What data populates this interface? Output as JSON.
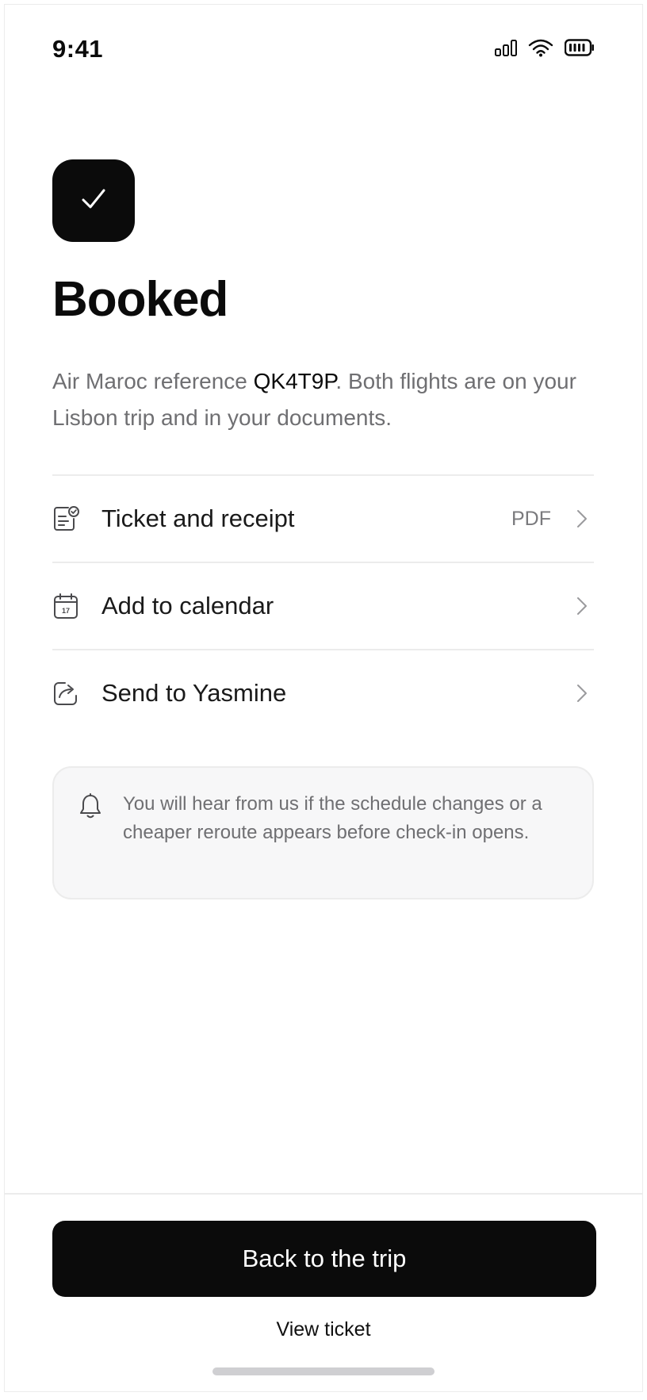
{
  "status_bar": {
    "time": "9:41",
    "icons": [
      "signal-icon",
      "wifi-icon",
      "battery-icon"
    ]
  },
  "badge": {
    "icon": "checkmark-icon"
  },
  "title": "Booked",
  "intro": {
    "prefix": "Air Maroc reference ",
    "reference": "QK4T9P",
    "suffix": ". Both flights are on your Lisbon trip and in your documents."
  },
  "actions": [
    {
      "label": "Ticket and receipt",
      "meta": "PDF",
      "icon": "receipt-check-icon"
    },
    {
      "label": "Add to calendar",
      "meta": "",
      "icon": "calendar-icon"
    },
    {
      "label": "Send to Yasmine",
      "meta": "",
      "icon": "share-icon"
    }
  ],
  "notice": {
    "icon": "bell-icon",
    "text": "You will hear from us if the schedule changes or a cheaper reroute appears before check-in opens."
  },
  "footer": {
    "primary_label": "Back to the trip",
    "secondary_label": "View ticket"
  },
  "colors": {
    "primary": "#0b0b0b",
    "muted_text": "#6f6f72",
    "divider": "#ececec",
    "card_bg": "#f7f7f8"
  }
}
